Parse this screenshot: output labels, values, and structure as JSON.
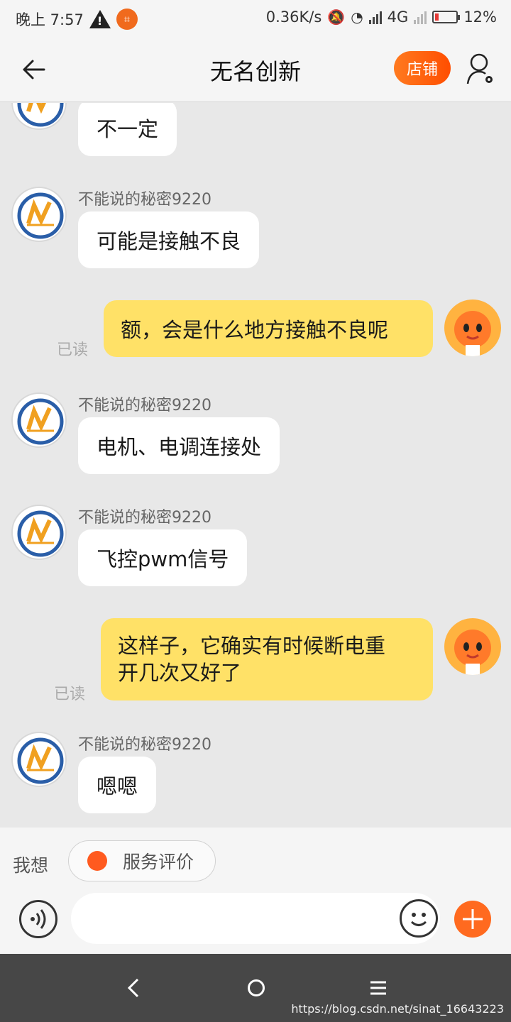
{
  "status_bar": {
    "time": "晚上 7:57",
    "network_speed": "0.36K/s",
    "network_type": "4G",
    "battery": "12%"
  },
  "header": {
    "title": "无名创新",
    "shop_button": "店铺"
  },
  "messages": [
    {
      "side": "left",
      "sender": "",
      "text": "不一定"
    },
    {
      "side": "left",
      "sender": "不能说的秘密9220",
      "text": "可能是接触不良"
    },
    {
      "side": "right",
      "status": "已读",
      "text": "额，会是什么地方接触不良呢"
    },
    {
      "side": "left",
      "sender": "不能说的秘密9220",
      "text": "电机、电调连接处"
    },
    {
      "side": "left",
      "sender": "不能说的秘密9220",
      "text": "飞控pwm信号"
    },
    {
      "side": "right",
      "status": "已读",
      "text_line1": "这样子，它确实有时候断电重",
      "text_line2": "开几次又好了"
    },
    {
      "side": "left",
      "sender": "不能说的秘密9220",
      "text": "嗯嗯"
    }
  ],
  "quick_reply": {
    "label": "我想",
    "chip": "服务评价"
  },
  "input": {
    "placeholder": ""
  },
  "watermark": "https://blog.csdn.net/sinat_16643223",
  "colors": {
    "accent": "#ff6a1f",
    "bubble_self": "#ffe167",
    "bubble_other": "#ffffff",
    "background": "#e8e8e8"
  }
}
